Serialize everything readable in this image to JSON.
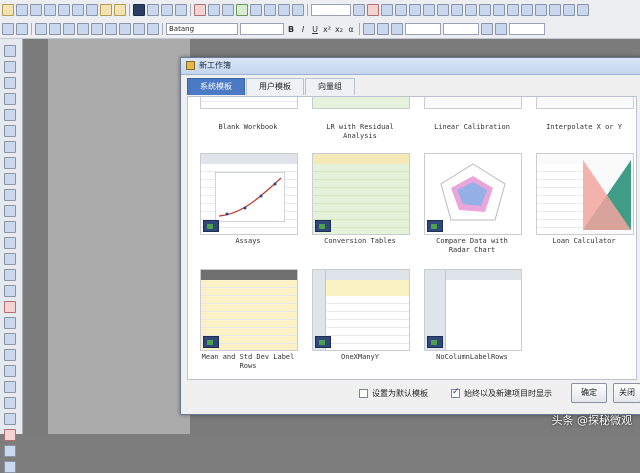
{
  "toolbar2": {
    "font_name": "Batang"
  },
  "dialog": {
    "title": "新工作簿",
    "tabs": [
      {
        "label": "系统模板"
      },
      {
        "label": "用户模板"
      },
      {
        "label": "向量组"
      }
    ],
    "templates": [
      {
        "label": "Blank Workbook"
      },
      {
        "label": "LR with Residual Analysis"
      },
      {
        "label": "Linear Calibration"
      },
      {
        "label": "Interpolate X or Y"
      },
      {
        "label": "Assays"
      },
      {
        "label": "Conversion Tables"
      },
      {
        "label": "Compare Data with Radar Chart"
      },
      {
        "label": "Loan Calculator"
      },
      {
        "label": "Mean and Std Dev Label Rows"
      },
      {
        "label": "OneXManyY"
      },
      {
        "label": "NoColumnLabelRows"
      }
    ],
    "checkbox_default": {
      "label": "设置为默认模板",
      "checked": false
    },
    "checkbox_open": {
      "label": "始终以及新建项目时显示",
      "checked": true
    },
    "ok_label": "确定",
    "close_label": "关闭"
  },
  "watermark": "头条 @探秘微观"
}
